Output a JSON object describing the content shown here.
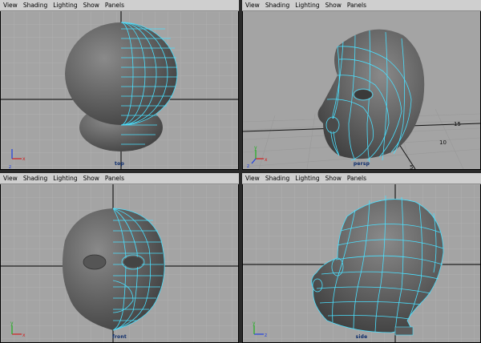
{
  "menu_labels": [
    "View",
    "Shading",
    "Lighting",
    "Show",
    "Panels"
  ],
  "viewports": {
    "top": {
      "label": "top"
    },
    "persp": {
      "label": "persp",
      "grid_ticks": [
        "15",
        "10",
        "5"
      ]
    },
    "front": {
      "label": "front"
    },
    "side": {
      "label": "side"
    }
  },
  "axis_labels": {
    "x": "x",
    "y": "y",
    "z": "z"
  },
  "colors": {
    "background": "#a4a4a4",
    "grid": "#b6b6b6",
    "origin_axes": "#000000",
    "wireframe": "#4ae0ff",
    "mesh_shade": "#606060",
    "menubar": "#cfcfcf",
    "axis_x": "#d02020",
    "axis_y": "#20b020",
    "axis_z": "#2040e0"
  },
  "icons": [
    "axis-gizmo-icon"
  ]
}
